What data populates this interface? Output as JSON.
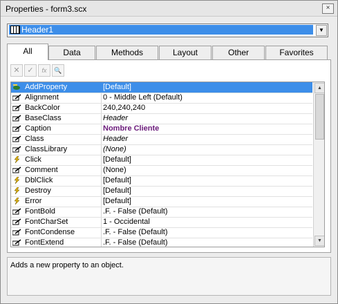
{
  "window": {
    "title": "Properties - form3.scx",
    "close_glyph": "×"
  },
  "object_combo": {
    "selected": "Header1",
    "icon": "grid-object-icon",
    "arrow": "▼"
  },
  "tabs": [
    {
      "label": "All",
      "active": true
    },
    {
      "label": "Data"
    },
    {
      "label": "Methods"
    },
    {
      "label": "Layout"
    },
    {
      "label": "Other"
    },
    {
      "label": "Favorites"
    }
  ],
  "toolbar": [
    {
      "icon": "cancel-icon",
      "glyph": "✕"
    },
    {
      "icon": "accept-icon",
      "glyph": "✓"
    },
    {
      "icon": "function-icon",
      "glyph": "fx"
    },
    {
      "icon": "zoom-icon",
      "glyph": "🔍"
    }
  ],
  "properties": [
    {
      "name": "AddProperty",
      "value": "[Default]",
      "icon": "method-icon",
      "selected": true
    },
    {
      "name": "Alignment",
      "value": "0 - Middle Left (Default)",
      "icon": "property-icon"
    },
    {
      "name": "BackColor",
      "value": "240,240,240",
      "icon": "property-icon"
    },
    {
      "name": "BaseClass",
      "value": "Header",
      "icon": "property-icon",
      "style": "italic"
    },
    {
      "name": "Caption",
      "value": "Nombre Cliente",
      "icon": "property-icon",
      "style": "bold"
    },
    {
      "name": "Class",
      "value": "Header",
      "icon": "property-icon",
      "style": "italic"
    },
    {
      "name": "ClassLibrary",
      "value": "(None)",
      "icon": "property-icon",
      "style": "italic"
    },
    {
      "name": "Click",
      "value": "[Default]",
      "icon": "event-icon"
    },
    {
      "name": "Comment",
      "value": "(None)",
      "icon": "property-icon"
    },
    {
      "name": "DblClick",
      "value": "[Default]",
      "icon": "event-icon"
    },
    {
      "name": "Destroy",
      "value": "[Default]",
      "icon": "event-icon"
    },
    {
      "name": "Error",
      "value": "[Default]",
      "icon": "event-icon"
    },
    {
      "name": "FontBold",
      "value": ".F. - False (Default)",
      "icon": "property-icon"
    },
    {
      "name": "FontCharSet",
      "value": "1 - Occidental",
      "icon": "property-icon"
    },
    {
      "name": "FontCondense",
      "value": ".F. - False (Default)",
      "icon": "property-icon"
    },
    {
      "name": "FontExtend",
      "value": ".F. - False (Default)",
      "icon": "property-icon"
    }
  ],
  "scrollbar": {
    "up": "▲",
    "down": "▼"
  },
  "description": "Adds a new property to an object.",
  "colors": {
    "selection": "#3d8ee9",
    "caption_value": "#6a1a7a"
  }
}
